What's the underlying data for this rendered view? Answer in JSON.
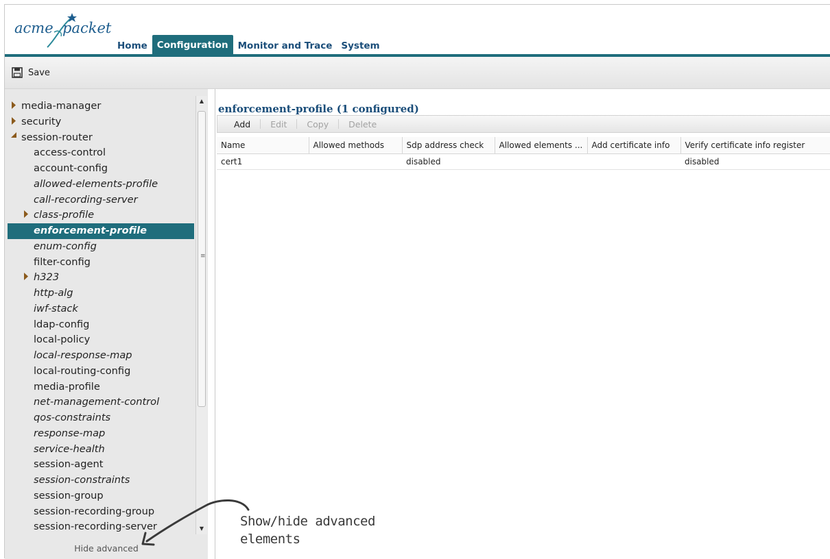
{
  "brand": {
    "logo_acme": "acme",
    "logo_packet": "packet",
    "accent": "#1f6d7c",
    "link": "#1b4e7a"
  },
  "nav": {
    "tabs": [
      {
        "label": "Home"
      },
      {
        "label": "Configuration",
        "active": true
      },
      {
        "label": "Monitor and Trace"
      },
      {
        "label": "System"
      }
    ]
  },
  "toolbar": {
    "save_label": "Save",
    "save_icon": "save-icon"
  },
  "sidebar": {
    "items": [
      {
        "label": "media-manager",
        "level": 0,
        "expander": "collapsed"
      },
      {
        "label": "security",
        "level": 0,
        "expander": "collapsed"
      },
      {
        "label": "session-router",
        "level": 0,
        "expander": "expanded"
      },
      {
        "label": "access-control",
        "level": 1
      },
      {
        "label": "account-config",
        "level": 1
      },
      {
        "label": "allowed-elements-profile",
        "level": 1,
        "italic": true
      },
      {
        "label": "call-recording-server",
        "level": 1,
        "italic": true
      },
      {
        "label": "class-profile",
        "level": 1,
        "italic": true,
        "expander": "collapsed"
      },
      {
        "label": "enforcement-profile",
        "level": 1,
        "italic": true,
        "selected": true
      },
      {
        "label": "enum-config",
        "level": 1,
        "italic": true
      },
      {
        "label": "filter-config",
        "level": 1
      },
      {
        "label": "h323",
        "level": 1,
        "italic": true,
        "expander": "collapsed"
      },
      {
        "label": "http-alg",
        "level": 1,
        "italic": true
      },
      {
        "label": "iwf-stack",
        "level": 1,
        "italic": true
      },
      {
        "label": "ldap-config",
        "level": 1
      },
      {
        "label": "local-policy",
        "level": 1
      },
      {
        "label": "local-response-map",
        "level": 1,
        "italic": true
      },
      {
        "label": "local-routing-config",
        "level": 1
      },
      {
        "label": "media-profile",
        "level": 1
      },
      {
        "label": "net-management-control",
        "level": 1,
        "italic": true
      },
      {
        "label": "qos-constraints",
        "level": 1,
        "italic": true
      },
      {
        "label": "response-map",
        "level": 1,
        "italic": true
      },
      {
        "label": "service-health",
        "level": 1,
        "italic": true
      },
      {
        "label": "session-agent",
        "level": 1
      },
      {
        "label": "session-constraints",
        "level": 1,
        "italic": true
      },
      {
        "label": "session-group",
        "level": 1
      },
      {
        "label": "session-recording-group",
        "level": 1
      },
      {
        "label": "session-recording-server",
        "level": 1
      }
    ],
    "hide_advanced_label": "Hide advanced"
  },
  "main": {
    "title": "enforcement-profile (1 configured)",
    "buttons": [
      {
        "label": "Add",
        "enabled": true
      },
      {
        "label": "Edit",
        "enabled": false
      },
      {
        "label": "Copy",
        "enabled": false
      },
      {
        "label": "Delete",
        "enabled": false
      }
    ],
    "columns": [
      "Name",
      "Allowed methods",
      "Sdp address check",
      "Allowed elements ...",
      "Add certificate info",
      "Verify certificate info register"
    ],
    "rows": [
      [
        "cert1",
        "",
        "disabled",
        "",
        "",
        "disabled"
      ]
    ]
  },
  "annotation": {
    "line1": "Show/hide advanced",
    "line2": "elements"
  }
}
